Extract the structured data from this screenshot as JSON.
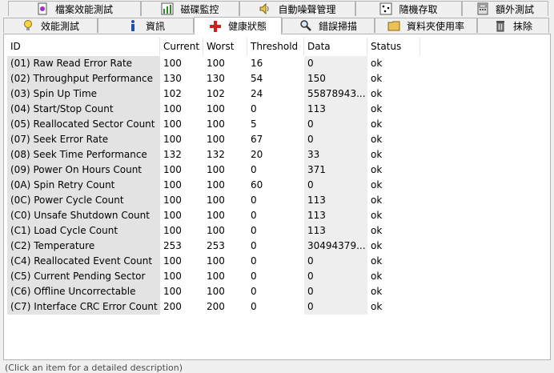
{
  "tabs_row1": [
    "檔案效能測試",
    "磁碟監控",
    "自動噪聲管理",
    "隨機存取",
    "額外測試"
  ],
  "tabs_row2": [
    "效能測試",
    "資訊",
    "健康狀態",
    "錯誤掃描",
    "資料夾使用率",
    "抹除"
  ],
  "active_tab": "健康狀態",
  "table": {
    "columns": [
      "ID",
      "Current",
      "Worst",
      "Threshold",
      "Data",
      "Status"
    ],
    "rows": [
      [
        "(01) Raw Read Error Rate",
        "100",
        "100",
        "16",
        "0",
        "ok"
      ],
      [
        "(02) Throughput Performance",
        "130",
        "130",
        "54",
        "150",
        "ok"
      ],
      [
        "(03) Spin Up Time",
        "102",
        "102",
        "24",
        "55878943...",
        "ok"
      ],
      [
        "(04) Start/Stop Count",
        "100",
        "100",
        "0",
        "113",
        "ok"
      ],
      [
        "(05) Reallocated Sector Count",
        "100",
        "100",
        "5",
        "0",
        "ok"
      ],
      [
        "(07) Seek Error Rate",
        "100",
        "100",
        "67",
        "0",
        "ok"
      ],
      [
        "(08) Seek Time Performance",
        "132",
        "132",
        "20",
        "33",
        "ok"
      ],
      [
        "(09) Power On Hours Count",
        "100",
        "100",
        "0",
        "371",
        "ok"
      ],
      [
        "(0A) Spin Retry Count",
        "100",
        "100",
        "60",
        "0",
        "ok"
      ],
      [
        "(0C) Power Cycle Count",
        "100",
        "100",
        "0",
        "113",
        "ok"
      ],
      [
        "(C0) Unsafe Shutdown Count",
        "100",
        "100",
        "0",
        "113",
        "ok"
      ],
      [
        "(C1) Load Cycle Count",
        "100",
        "100",
        "0",
        "113",
        "ok"
      ],
      [
        "(C2) Temperature",
        "253",
        "253",
        "0",
        "30494379...",
        "ok"
      ],
      [
        "(C4) Reallocated Event Count",
        "100",
        "100",
        "0",
        "0",
        "ok"
      ],
      [
        "(C5) Current Pending Sector",
        "100",
        "100",
        "0",
        "0",
        "ok"
      ],
      [
        "(C6) Offline Uncorrectable",
        "100",
        "100",
        "0",
        "0",
        "ok"
      ],
      [
        "(C7) Interface CRC Error Count",
        "200",
        "200",
        "0",
        "0",
        "ok"
      ]
    ]
  },
  "footer_text": "(Click an item for a detailed description)",
  "icons": {
    "tabs_row1": [
      "file-benchmark-icon",
      "disk-monitor-icon",
      "speaker-icon",
      "random-access-icon",
      "extra-tests-icon"
    ],
    "tabs_row2": [
      "lightbulb-icon",
      "info-icon",
      "red-cross-icon",
      "magnifier-icon",
      "folder-icon",
      "trash-icon"
    ]
  }
}
